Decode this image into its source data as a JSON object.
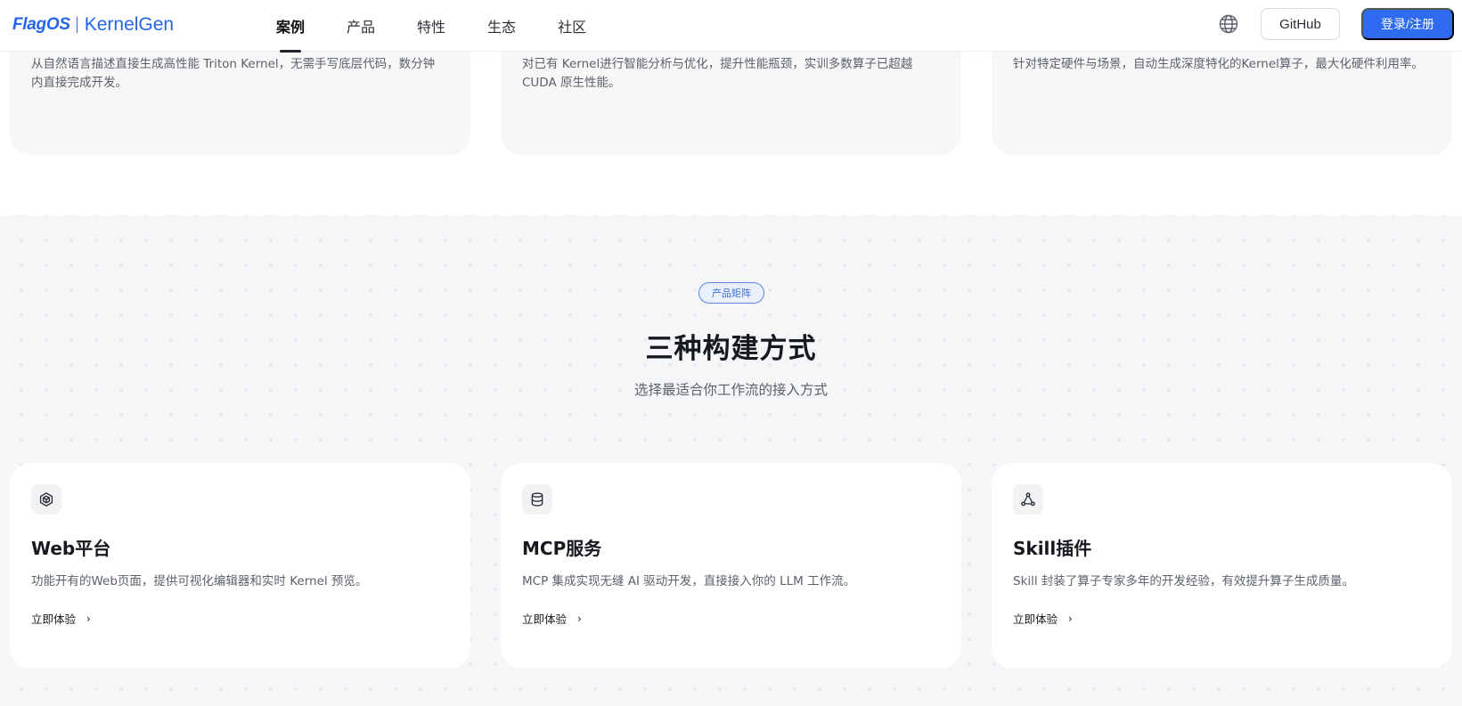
{
  "nav": {
    "logo_brand": "FlagOS",
    "logo_product": "KernelGen",
    "links": [
      {
        "label": "案例",
        "active": true
      },
      {
        "label": "产品",
        "active": false
      },
      {
        "label": "特性",
        "active": false
      },
      {
        "label": "生态",
        "active": false
      },
      {
        "label": "社区",
        "active": false
      }
    ],
    "globe_icon": "globe-icon",
    "github_label": "GitHub",
    "login_label": "登录/注册"
  },
  "features": [
    {
      "desc": "从自然语言描述直接生成高性能 Triton Kernel，无需手写底层代码，数分钟内直接完成开发。"
    },
    {
      "desc": "对已有 Kernel进行智能分析与优化，提升性能瓶颈，实训多数算子已超越 CUDA 原生性能。"
    },
    {
      "desc": "针对特定硬件与场景，自动生成深度特化的Kernel算子，最大化硬件利用率。"
    }
  ],
  "matrix": {
    "tag": "产品矩阵",
    "title": "三种构建方式",
    "subtitle": "选择最适合你工作流的接入方式",
    "cards": [
      {
        "icon": "hexagon-cube-icon",
        "title": "Web平台",
        "desc": "功能开有的Web页面，提供可视化编辑器和实时 Kernel 预览。",
        "link": "立即体验"
      },
      {
        "icon": "database-icon",
        "title": "MCP服务",
        "desc": "MCP 集成实现无缝 AI 驱动开发，直接接入你的 LLM 工作流。",
        "link": "立即体验"
      },
      {
        "icon": "network-nodes-icon",
        "title": "Skill插件",
        "desc": "Skill 封装了算子专家多年的开发经验，有效提升算子生成质量。",
        "link": "立即体验"
      }
    ]
  },
  "colors": {
    "brand": "#2463eb",
    "primary_button": "#2f6bf0",
    "section_bg": "#f5f6f8",
    "card_bg": "#ffffff"
  }
}
